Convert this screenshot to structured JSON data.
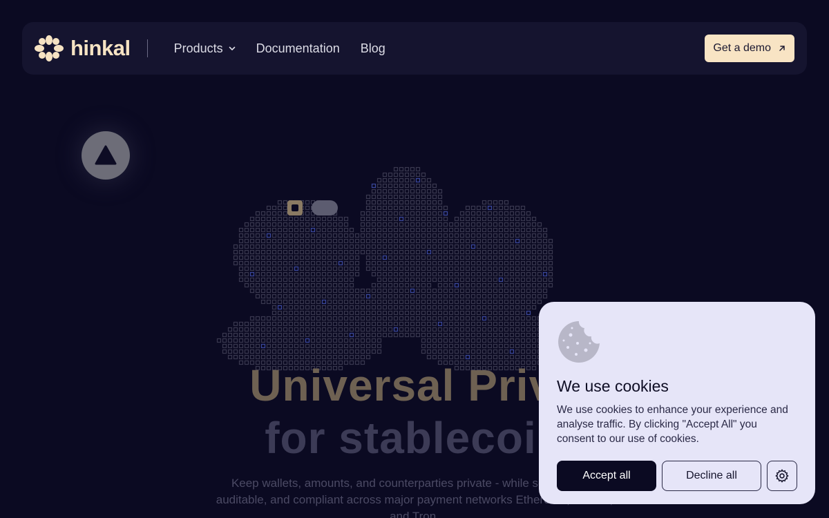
{
  "nav": {
    "logo_text": "hinkal",
    "items": [
      {
        "label": "Products",
        "has_dropdown": true
      },
      {
        "label": "Documentation"
      },
      {
        "label": "Blog"
      }
    ],
    "cta_label": "Get a demo",
    "cta_icon": "arrow-up-right-icon"
  },
  "hero": {
    "title": "Universal Priva",
    "subtitle": "for stablecoin",
    "description": "Keep wallets, amounts, and counterparties private -  while settle public, auditable, and compliant across major payment networks Ethereum, Solana, and Tron."
  },
  "cookie_banner": {
    "title": "We use cookies",
    "text": "We use cookies to enhance your experience and analyse traffic. By clicking \"Accept All\" you consent to our use of cookies.",
    "accept_label": "Accept all",
    "decline_label": "Decline all",
    "settings_icon": "gear-icon"
  },
  "colors": {
    "background": "#0b0a22",
    "navbar": "#15142f",
    "accent": "#f8e4c4",
    "cookie_panel": "#e6e5f8"
  }
}
